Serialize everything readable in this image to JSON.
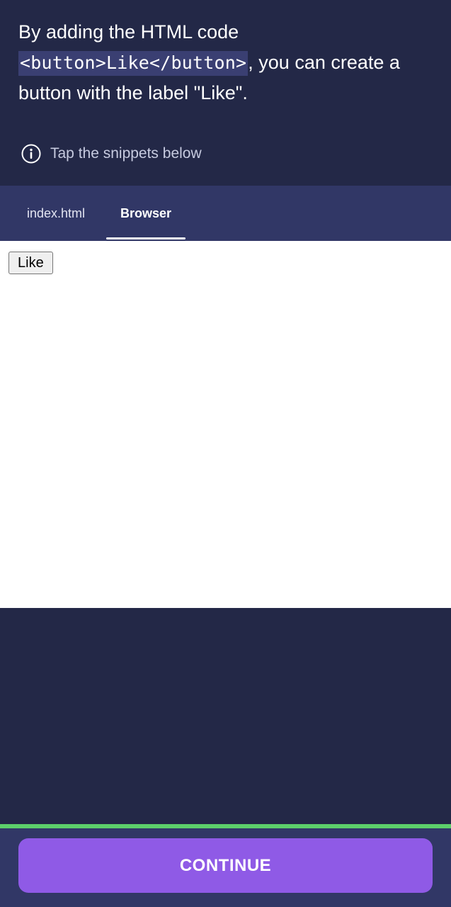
{
  "lesson": {
    "text_before": "By adding the HTML code ",
    "code_snippet": "<button>Like</button>",
    "text_after": ", you can create a button with the label \"Like\"."
  },
  "hint": {
    "icon": "info-icon",
    "text": "Tap the snippets below"
  },
  "tabs": [
    {
      "label": "index.html",
      "active": false
    },
    {
      "label": "Browser",
      "active": true
    }
  ],
  "browser": {
    "button_label": "Like"
  },
  "progress": {
    "fraction": 1.0
  },
  "footer": {
    "continue_label": "CONTINUE"
  },
  "colors": {
    "background": "#232847",
    "tab_bar": "#313766",
    "accent": "#8f5ae6",
    "progress": "#5cd06b"
  }
}
